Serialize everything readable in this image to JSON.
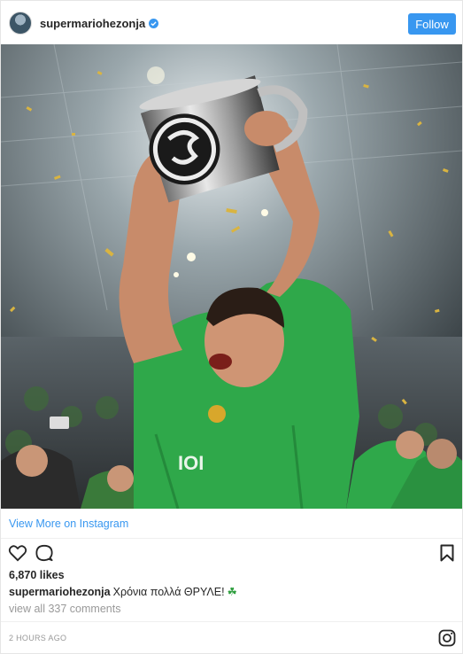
{
  "post": {
    "username": "supermariohezonja",
    "follow_label": "Follow",
    "view_more_label": "View More on Instagram",
    "likes": "6,870 likes",
    "caption_user": "supermariohezonja",
    "caption_text": "Χρόνια πολλά ΘΡΥΛΕ!",
    "caption_emoji": "☘",
    "view_comments": "view all 337 comments",
    "time_ago": "2 HOURS AGO"
  },
  "icons": {
    "verified": "verified-icon",
    "like": "heart-icon",
    "comment": "comment-icon",
    "save": "bookmark-icon",
    "brand": "instagram-icon"
  },
  "colors": {
    "accent": "#3897f0",
    "jersey_green": "#2fa84a",
    "muted_text": "#999999"
  }
}
